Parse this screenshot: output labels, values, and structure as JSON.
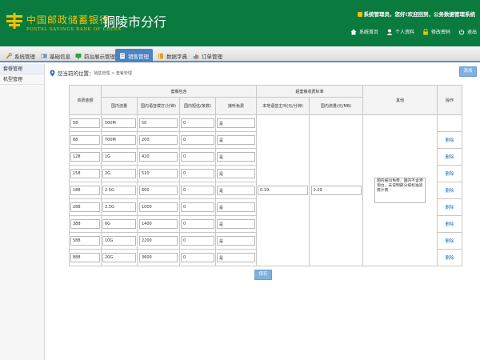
{
  "header": {
    "bank_name_cn": "中国邮政储蓄银行",
    "bank_name_en": "POSTAL SAVINGS BANK OF CHINA",
    "branch": "铜陵市分行",
    "welcome": "系统管理员，您好!欢迎回到，公务数据管理系统",
    "links": [
      {
        "label": "系统首页",
        "icon": "home-icon"
      },
      {
        "label": "个人资料",
        "icon": "user-icon"
      },
      {
        "label": "修改密码",
        "icon": "lock-icon"
      },
      {
        "label": "退出",
        "icon": "power-icon"
      }
    ],
    "colors": {
      "brand_green": "#0b7a3e",
      "logo_yellow": "#f2c200"
    }
  },
  "nav": {
    "tabs": [
      {
        "label": "系统管理",
        "icon": "wrench-icon"
      },
      {
        "label": "基础信息",
        "icon": "id-card-icon"
      },
      {
        "label": "前台展示管理",
        "icon": "display-icon"
      },
      {
        "label": "销售管理",
        "icon": "document-icon",
        "active": true
      },
      {
        "label": "数据字典",
        "icon": "book-icon"
      },
      {
        "label": "订单管理",
        "icon": "chart-icon"
      }
    ],
    "accent": "#4d83c0"
  },
  "sidebar": {
    "items": [
      {
        "label": "套餐管理",
        "active": true
      },
      {
        "label": "机型管理",
        "active": false
      }
    ]
  },
  "breadcrumb": {
    "prefix": "您当前的位置：",
    "path": "销售管理 > 套餐管理"
  },
  "add_button": "添加",
  "save_button": "保存",
  "table": {
    "headers": {
      "base_fee": "资费金额",
      "package_group": "套餐包含",
      "overage_group": "超套餐收费标准",
      "remark": "其他",
      "action": "操作",
      "sub": [
        "国内流量",
        "国内语音拨打(分钟)",
        "国内短信(条数)",
        "接听免费",
        "本地语音主叫(元/分钟)",
        "国内流量(元/MB)"
      ]
    },
    "rows": [
      {
        "fee": "58",
        "data": "500M",
        "voice": "50",
        "sms": "0",
        "free": "是",
        "action": ""
      },
      {
        "fee": "88",
        "data": "700M",
        "voice": "200",
        "sms": "0",
        "free": "是",
        "action": "删除"
      },
      {
        "fee": "128",
        "data": "1G",
        "voice": "420",
        "sms": "0",
        "free": "是",
        "action": "删除"
      },
      {
        "fee": "158",
        "data": "2G",
        "voice": "510",
        "sms": "0",
        "free": "是",
        "action": "删除"
      },
      {
        "fee": "188",
        "data": "2.5G",
        "voice": "600",
        "sms": "0",
        "free": "是",
        "action": "删除"
      },
      {
        "fee": "288",
        "data": "3.5G",
        "voice": "1000",
        "sms": "0",
        "free": "是",
        "action": "删除"
      },
      {
        "fee": "388",
        "data": "6G",
        "voice": "1400",
        "sms": "0",
        "free": "是",
        "action": "删除"
      },
      {
        "fee": "588",
        "data": "10G",
        "voice": "2200",
        "sms": "0",
        "free": "是",
        "action": "删除"
      },
      {
        "fee": "888",
        "data": "20G",
        "voice": "3600",
        "sms": "0",
        "free": "是",
        "action": "删除"
      }
    ],
    "overage_voice": "0.19",
    "overage_data": "0.29",
    "remark": "国内被叫免费，国内不含港澳台，未说明部分按标准资费计费"
  }
}
